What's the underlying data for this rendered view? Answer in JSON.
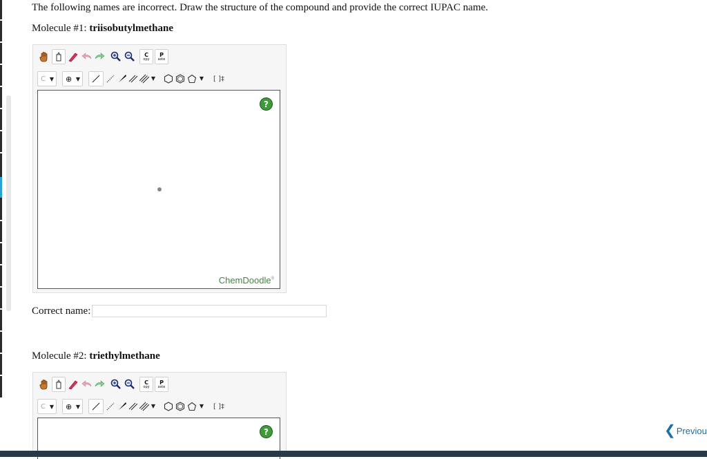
{
  "instructions": "The following names are incorrect. Draw the structure of the compound and provide the correct IUPAC name.",
  "molecules": [
    {
      "label": "Molecule #1:",
      "name": "triisobutylmethane"
    },
    {
      "label": "Molecule #2:",
      "name": "triethylmethane"
    }
  ],
  "toolbar": {
    "copy_label": "C",
    "copy_sub": "opy",
    "paste_label": "P",
    "paste_sub": "aste",
    "element_label": "C",
    "charge_label": "⊕",
    "bracket_label": "[ ]‡"
  },
  "editor": {
    "help_label": "?",
    "brand": "ChemDoodle",
    "brand_mark": "®"
  },
  "answer": {
    "label": "Correct name:",
    "value": ""
  },
  "navigation": {
    "previous_label": "Previous"
  },
  "colors": {
    "accent": "#29a3d6",
    "brand_green": "#3d8a3d",
    "link": "#1d6fa5"
  }
}
